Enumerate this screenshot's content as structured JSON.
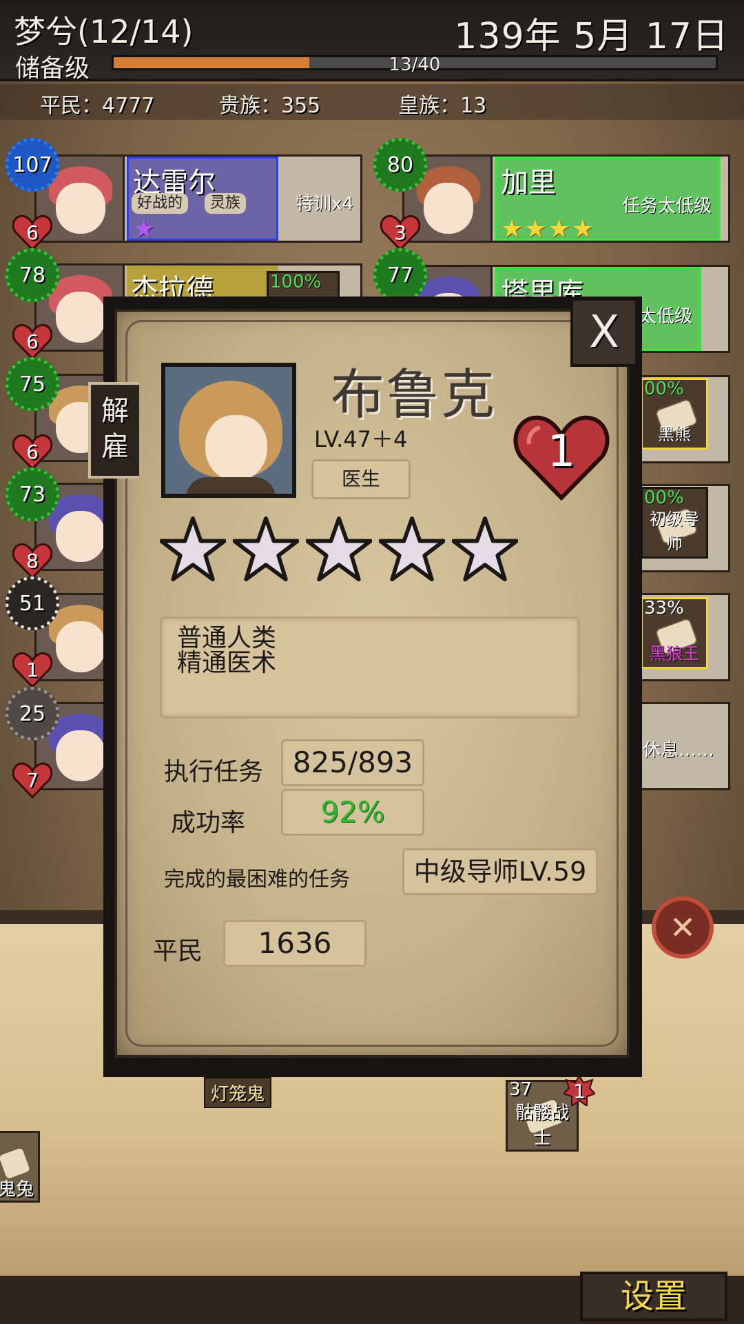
{
  "header": {
    "guild_name": "梦兮(12/14)",
    "date": "139年 5月 17日",
    "rank": "储备级",
    "exp_text": "13/40",
    "exp_fraction": 0.325
  },
  "population": {
    "commoners": "平民：4777",
    "nobles": "贵族：355",
    "royals": "皇族：13"
  },
  "roster": [
    {
      "name": "达雷尔",
      "level": "107",
      "hearts": "6",
      "tags": [
        "好战的",
        "灵族"
      ],
      "note": "特训x4"
    },
    {
      "name": "加里",
      "level": "80",
      "hearts": "3",
      "note": "任务太低级",
      "stars": "★★★★"
    },
    {
      "name": "杰拉德",
      "level": "78",
      "hearts": "6",
      "pct": "100%"
    },
    {
      "name": "塔里库",
      "level": "77",
      "note": "任务太低级"
    },
    {
      "level": "75",
      "hearts": "6"
    },
    {
      "level": "73",
      "hearts": "8"
    },
    {
      "level": "51",
      "hearts": "1"
    },
    {
      "level": "25",
      "hearts": "7"
    }
  ],
  "side_tasks": [
    {
      "pct": "00%",
      "name": "黑熊"
    },
    {
      "pct": "00%",
      "name": "初级导师"
    },
    {
      "pct": "33%",
      "name": "黑狼王"
    },
    {
      "name": "休息……"
    }
  ],
  "modal": {
    "dismiss_label": "解雇",
    "close_label": "X",
    "hero_name": "布鲁克",
    "hero_level": "LV.47＋4",
    "hero_job": "医生",
    "hero_hearts": "1",
    "stars_filled": 0,
    "stars_total": 5,
    "desc_line1": "普通人类",
    "desc_line2": "精通医术",
    "missions_label": "执行任务",
    "missions_value": "825/893",
    "success_label": "成功率",
    "success_value": "92%",
    "hardest_label": "完成的最困难的任务",
    "hardest_value": "中级导师LV.59",
    "class_label": "平民",
    "class_value": "1636"
  },
  "floor": {
    "task1": "灯笼鬼",
    "task2_count": "37",
    "task2_badge": "1",
    "task2": "骷髅战士",
    "task3": "鬼兔"
  },
  "settings_label": "设置",
  "colors": {
    "accent_orange": "#d77e35",
    "success_green": "#2fb62f",
    "settings_yellow": "#f6d84a"
  }
}
